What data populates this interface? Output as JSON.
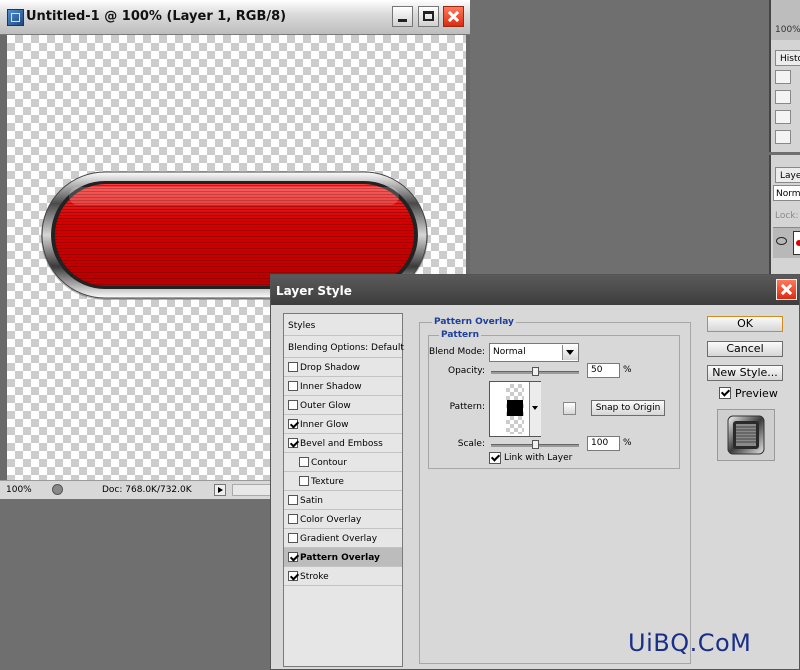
{
  "document": {
    "title": "Untitled-1 @ 100% (Layer 1, RGB/8)",
    "zoom": "100%",
    "doc_size": "Doc: 768.0K/732.0K"
  },
  "panels": {
    "zoom": "100%",
    "history_tab": "Histo",
    "layers_tab": "Laye",
    "blend_mode": "Norma",
    "lock_label": "Lock:"
  },
  "dialog": {
    "title": "Layer Style",
    "styles_header": "Styles",
    "blending_options": "Blending Options: Default",
    "effects": [
      {
        "label": "Drop Shadow",
        "checked": false
      },
      {
        "label": "Inner Shadow",
        "checked": false
      },
      {
        "label": "Outer Glow",
        "checked": false
      },
      {
        "label": "Inner Glow",
        "checked": true
      },
      {
        "label": "Bevel and Emboss",
        "checked": true
      },
      {
        "label": "Contour",
        "checked": false
      },
      {
        "label": "Texture",
        "checked": false
      },
      {
        "label": "Satin",
        "checked": false
      },
      {
        "label": "Color Overlay",
        "checked": false
      },
      {
        "label": "Gradient Overlay",
        "checked": false
      },
      {
        "label": "Pattern Overlay",
        "checked": true
      },
      {
        "label": "Stroke",
        "checked": true
      }
    ],
    "pattern_overlay": {
      "group_title": "Pattern Overlay",
      "sub_title": "Pattern",
      "blend_mode_label": "Blend Mode:",
      "blend_mode_value": "Normal",
      "opacity_label": "Opacity:",
      "opacity_value": "50",
      "opacity_level": 50,
      "pattern_label": "Pattern:",
      "snap_button": "Snap to Origin",
      "scale_label": "Scale:",
      "scale_value": "100",
      "scale_level": 50,
      "percent": "%",
      "link_with_layer": "Link with Layer",
      "link_checked": true
    },
    "buttons": {
      "ok": "OK",
      "cancel": "Cancel",
      "new_style": "New Style...",
      "preview": "Preview",
      "preview_checked": true
    }
  },
  "watermark": "UiBQ.CoM"
}
